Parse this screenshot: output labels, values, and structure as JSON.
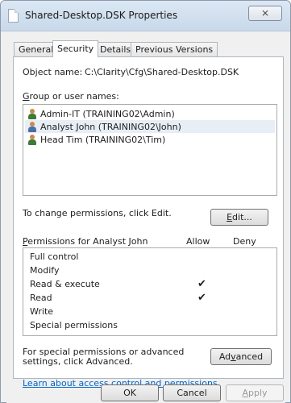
{
  "window": {
    "title": "Shared-Desktop.DSK Properties",
    "close_label": "⨯"
  },
  "tabs": [
    {
      "label": "General",
      "active": false
    },
    {
      "label": "Security",
      "active": true
    },
    {
      "label": "Details",
      "active": false
    },
    {
      "label": "Previous Versions",
      "active": false
    }
  ],
  "security": {
    "object_name_label": "Object name:",
    "object_name_value": "C:\\Clarity\\Cfg\\Shared-Desktop.DSK",
    "group_label_first": "G",
    "group_label_rest": "roup or user names:",
    "users": [
      {
        "name": "Admin-IT (TRAINING02\\Admin)",
        "icon": "user-icon-green",
        "selected": false
      },
      {
        "name": "Analyst John (TRAINING02\\John)",
        "icon": "user-icon-blue",
        "selected": true
      },
      {
        "name": "Head Tim (TRAINING02\\Tim)",
        "icon": "user-icon-green",
        "selected": false
      }
    ],
    "change_text": "To change permissions, click Edit.",
    "edit_button_first": "E",
    "edit_button_rest": "dit...",
    "permissions_label_first": "P",
    "permissions_label_rest": "ermissions for Analyst John",
    "allow_header": "Allow",
    "deny_header": "Deny",
    "permissions": [
      {
        "name": "Full control",
        "allow": "",
        "deny": ""
      },
      {
        "name": "Modify",
        "allow": "",
        "deny": ""
      },
      {
        "name": "Read & execute",
        "allow": "✔",
        "deny": ""
      },
      {
        "name": "Read",
        "allow": "✔",
        "deny": ""
      },
      {
        "name": "Write",
        "allow": "",
        "deny": ""
      },
      {
        "name": "Special permissions",
        "allow": "",
        "deny": ""
      }
    ],
    "special_text": "For special permissions or advanced settings, click Advanced.",
    "advanced_button_pre": "Ad",
    "advanced_button_u": "v",
    "advanced_button_post": "anced",
    "learn_link": "Learn about access control and permissions"
  },
  "footer": {
    "ok_label": "OK",
    "cancel_label": "Cancel",
    "apply_label_first": "A",
    "apply_label_rest": "pply"
  }
}
